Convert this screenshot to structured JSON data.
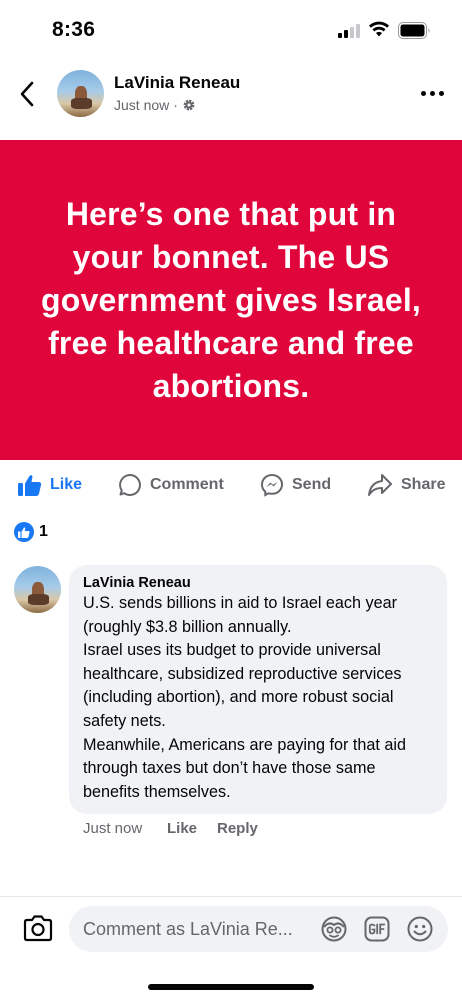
{
  "status_bar": {
    "time": "8:36"
  },
  "post": {
    "author": "LaVinia Reneau",
    "timestamp": "Just now",
    "separator": "·",
    "privacy_icon": "gear-icon",
    "banner_color": "#e0053a",
    "text": "Here’s one that put in your bonnet. The US government gives Israel, free healthcare and free abortions."
  },
  "actions": {
    "like": "Like",
    "comment": "Comment",
    "send": "Send",
    "share": "Share"
  },
  "reactions": {
    "count": "1",
    "type": "like"
  },
  "comment": {
    "author": "LaVinia Reneau",
    "text": "U.S. sends billions in aid to Israel each year (roughly $3.8 billion annually.\nIsrael uses its budget to provide universal healthcare, subsidized reproductive services (including abortion), and more robust social safety nets.\nMeanwhile, Americans are paying for that aid through taxes but don’t have those same benefits themselves.",
    "time": "Just now",
    "like_label": "Like",
    "reply_label": "Reply"
  },
  "composer": {
    "placeholder": "Comment as LaVinia Re..."
  },
  "colors": {
    "accent": "#1877f2",
    "banner": "#e0053a",
    "secondary_text": "#65676b",
    "bubble": "#f0f2f5"
  }
}
